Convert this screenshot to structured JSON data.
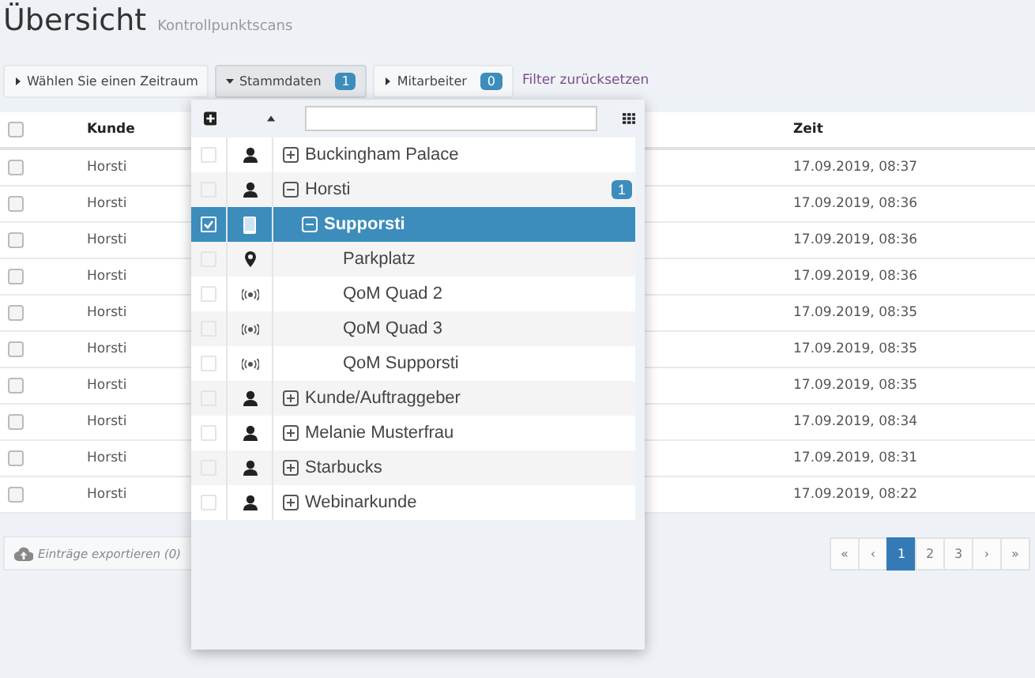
{
  "page": {
    "title": "Übersicht",
    "subtitle": "Kontrollpunktscans"
  },
  "filters": [
    {
      "label": "Wählen Sie einen Zeitraum",
      "expanded": false
    },
    {
      "label": "Stammdaten",
      "expanded": true,
      "count": "1"
    },
    {
      "label": "Mitarbeiter",
      "expanded": false,
      "count": "0"
    }
  ],
  "reset_link": "Filter zurücksetzen",
  "table": {
    "header_checked": false,
    "columns": [
      "Kunde",
      "Zeit"
    ],
    "rows": [
      {
        "checked": false,
        "cells": [
          "Horsti",
          "17.09.2019, 08:37"
        ]
      },
      {
        "checked": false,
        "cells": [
          "Horsti",
          "17.09.2019, 08:36"
        ]
      },
      {
        "checked": false,
        "cells": [
          "Horsti",
          "17.09.2019, 08:36"
        ]
      },
      {
        "checked": false,
        "cells": [
          "Horsti",
          "17.09.2019, 08:36"
        ]
      },
      {
        "checked": false,
        "cells": [
          "Horsti",
          "17.09.2019, 08:35"
        ]
      },
      {
        "checked": false,
        "cells": [
          "Horsti",
          "17.09.2019, 08:35"
        ]
      },
      {
        "checked": false,
        "cells": [
          "Horsti",
          "17.09.2019, 08:35"
        ]
      },
      {
        "checked": false,
        "cells": [
          "Horsti",
          "17.09.2019, 08:34"
        ]
      },
      {
        "checked": false,
        "cells": [
          "Horsti",
          "17.09.2019, 08:31"
        ]
      },
      {
        "checked": false,
        "cells": [
          "Horsti",
          "17.09.2019, 08:22"
        ]
      }
    ]
  },
  "export_button": "Einträge exportieren (0)",
  "pagination": [
    {
      "label": "«",
      "selected": false
    },
    {
      "label": "‹",
      "selected": false
    },
    {
      "label": "1",
      "selected": true
    },
    {
      "label": "2",
      "selected": false
    },
    {
      "label": "3",
      "selected": false
    },
    {
      "label": "›",
      "selected": false
    },
    {
      "label": "»",
      "selected": false
    }
  ],
  "dropdown": {
    "items": [
      {
        "label": "Buckingham Palace",
        "kind": "person",
        "expanded": false,
        "checked": false,
        "selected": false
      },
      {
        "label": "Horsti",
        "kind": "person",
        "expanded": true,
        "checked": false,
        "selected": false,
        "count": "1",
        "children": [
          {
            "label": "Supporsti",
            "kind": "device",
            "expanded": true,
            "checked": true,
            "selected": true,
            "children": [
              {
                "label": "Parkplatz",
                "kind": "pin",
                "checked": false,
                "selected": false
              },
              {
                "label": "QoM Quad 2",
                "kind": "signal",
                "checked": false,
                "selected": false
              },
              {
                "label": "QoM Quad 3",
                "kind": "signal",
                "checked": false,
                "selected": false
              },
              {
                "label": "QoM Supporsti",
                "kind": "signal",
                "checked": false,
                "selected": false
              }
            ]
          }
        ]
      },
      {
        "label": "Kunde/Auftraggeber",
        "kind": "person",
        "expanded": false,
        "checked": false,
        "selected": false
      },
      {
        "label": "Melanie Musterfrau",
        "kind": "person",
        "expanded": false,
        "checked": false,
        "selected": false
      },
      {
        "label": "Starbucks",
        "kind": "person",
        "expanded": false,
        "checked": false,
        "selected": false
      },
      {
        "label": "Webinarkunde",
        "kind": "person",
        "expanded": false,
        "checked": false,
        "selected": false
      }
    ]
  }
}
